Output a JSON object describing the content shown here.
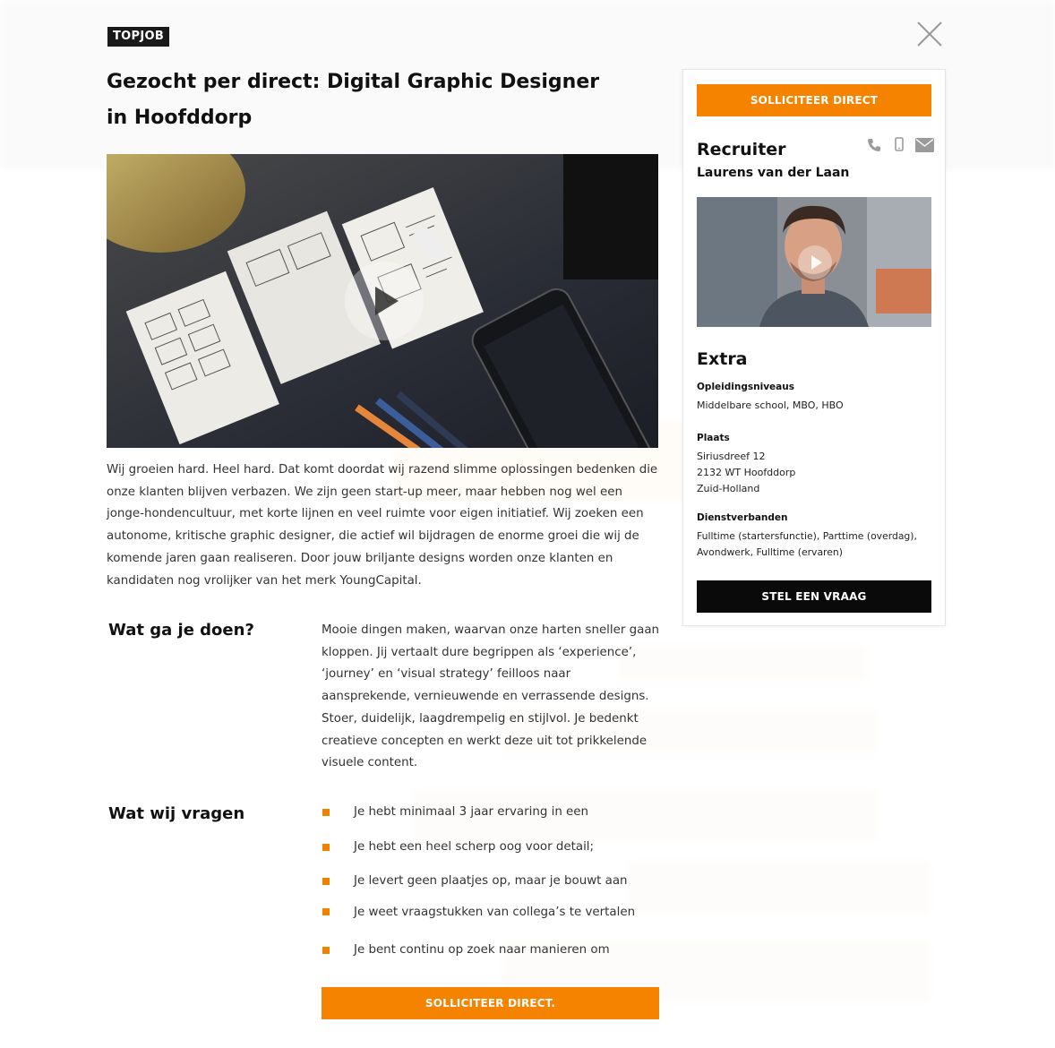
{
  "badge": "TOPJOB",
  "title": "Gezocht per direct: Digital Graphic Designer in Hoofddorp",
  "intro": "Wij groeien hard. Heel hard. Dat komt doordat wij razend slimme oplossingen bedenken die onze klanten blijven verbazen. We zijn geen start-up meer, maar hebben nog wel een jonge-hondencultuur, met korte lijnen en veel ruimte voor eigen initiatief. Wij zoeken een autonome, kritische graphic designer, die actief wil bijdragen de enorme groei die wij de komende jaren gaan realiseren. Door jouw briljante designs worden onze klanten en kandidaten nog vrolijker van het merk YoungCapital.",
  "sections": {
    "doen": {
      "heading": "Wat ga je doen?",
      "body": "Mooie dingen maken, waarvan onze harten sneller gaan kloppen. Jij vertaalt dure begrippen als ‘experience’, ‘journey’ en ‘visual strategy’ feilloos naar aansprekende, vernieuwende en verrassende designs. Stoer, duidelijk, laagdrempelig en stijlvol. Je bedenkt creatieve concepten en werkt deze uit tot prikkelende visuele content."
    },
    "vragen": {
      "heading": "Wat wij vragen",
      "items": [
        "Je hebt minimaal 3 jaar ervaring in een",
        "Je hebt een heel scherp oog voor detail;",
        "Je levert geen plaatjes op, maar je bouwt aan",
        "Je weet vraagstukken van collega’s te vertalen",
        "Je bent continu op zoek naar manieren om"
      ]
    }
  },
  "apply_bottom": "SOLLICITEER DIRECT.",
  "sidebar": {
    "apply_top": "SOLLICITEER DIRECT",
    "recruiter_heading": "Recruiter",
    "recruiter_name": "Laurens van der Laan",
    "extra_heading": "Extra",
    "education_label": "Opleidingsniveaus",
    "education_value": "Middelbare school, MBO, HBO",
    "place_label": "Plaats",
    "place_street": "Siriusdreef 12",
    "place_city": "2132 WT Hoofddorp",
    "place_region": "Zuid-Holland",
    "employment_label": "Dienstverbanden",
    "employment_value": "Fulltime (startersfunctie), Parttime (overdag), Avondwerk, Fulltime (ervaren)",
    "ask_button": "STEL EEN VRAAG"
  },
  "colors": {
    "accent": "#f58300",
    "dark": "#0a0a0a"
  },
  "icons": [
    "close-icon",
    "phone-icon",
    "mobile-icon",
    "mail-icon",
    "play-icon"
  ]
}
